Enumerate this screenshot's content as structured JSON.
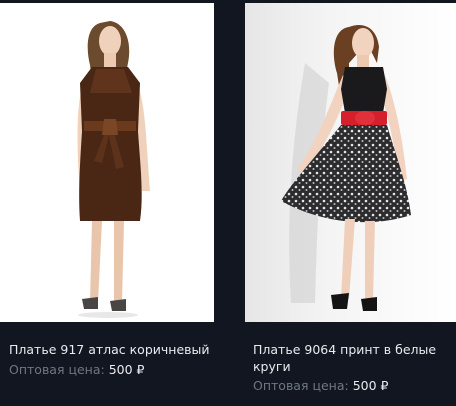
{
  "products": [
    {
      "title": "Платье 917 атлас коричневый",
      "price_label": "Оптовая цена:",
      "price_value": "500 ₽"
    },
    {
      "title": "Платье 9064 принт в белые круги",
      "price_label": "Оптовая цена:",
      "price_value": "500 ₽"
    }
  ]
}
